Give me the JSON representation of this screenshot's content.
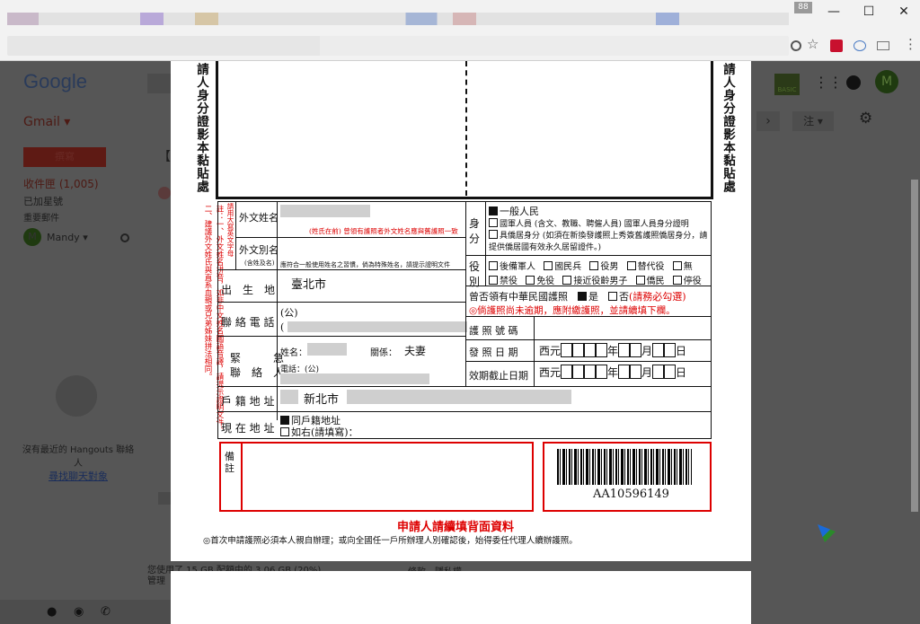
{
  "browser": {
    "tab_badge": "88",
    "window_controls": {
      "minimize": "—",
      "maximize": "☐",
      "close": "✕"
    }
  },
  "gmail": {
    "logo": "Google",
    "label": "Gmail ▾",
    "compose": "撰寫",
    "inbox": "收件匣 (1,005)",
    "starred": "已加星號",
    "important": "重要郵件",
    "user": "Mandy ▾",
    "user_initial": "M",
    "hangouts_empty": "沒有最近的 Hangouts 聯絡人",
    "find_people": "尋找聊天對象",
    "storage": "您使用了 15 GB 配額中的 3.06 GB (20%)",
    "manage": "管理",
    "terms": "條款 - 隱私權",
    "basic_badge": "BASIC",
    "account_initial": "M",
    "toolbar_more": "注 ▾",
    "subject_prefix": "【"
  },
  "form": {
    "photo_label_left": "請人身分證影本黏貼處",
    "photo_label_right": "請人身分證影本黏貼處",
    "note_col": "註：一、外文姓名拼音，如非中文姓名國語音譯，請提示證明文件。二、建議外文姓氏與直系血親或兄弟姊妹拼法相同。",
    "side_red": "請用大寫英文字母",
    "foreign_name": "外文姓名",
    "foreign_alias": "外文別名",
    "alias_sub": "(含姓及名)",
    "name_note": "(姓氏在前) 曾領有護照者外文姓名應與舊護照一致",
    "alias_note": "應符合一般使用姓名之習慣，倘為特殊姓名，請提示證明文件",
    "birthplace": "出　生　地",
    "birthplace_value": "臺北市",
    "phone": "聯 絡 電 話",
    "phone_office": "(公)",
    "phone_home": "(",
    "emergency_1": "緊　　　急",
    "emergency_2": "聯　絡　人",
    "ec_name": "姓名：",
    "ec_relation": "關係：",
    "ec_relation_value": "夫妻",
    "ec_phone": "電話：(公)",
    "household_addr": "戶 籍 地 址",
    "household_value": "新北市",
    "current_addr": "現 在 地 址",
    "same_addr": "同戶籍地址",
    "other_addr": "如右(請填寫)：",
    "identity_label": "身分",
    "identity_opts": [
      "一般人民",
      "國軍人員 (含文、教職、聘僱人員) 國軍人員身分證明",
      "具僑居身分 (如須在新換發護照上秀簽舊護照僑居身分，請提供僑居國有效永久居留證件。)"
    ],
    "service_label": "役別",
    "service_row1": [
      "後備軍人",
      "國民兵",
      "役男",
      "替代役",
      "無"
    ],
    "service_row2": [
      "禁役",
      "免役",
      "接近役齡男子",
      "僑民",
      "停役"
    ],
    "passport_q": "曾否領有中華民國護照",
    "yes": "是",
    "no": "否",
    "must_check": "(請務必勾選)",
    "expired_note": "◎倘護照尚未逾期，應附繳護照，並請續填下欄。",
    "passport_no": "護 照 號 碼",
    "issue_date": "發 照 日 期",
    "expiry_date": "效期截止日期",
    "roc": "西元",
    "year": "年",
    "month": "月",
    "day": "日",
    "remarks": "備　　　　註",
    "barcode_text": "AA10596149",
    "continue_back": "申請人請續填背面資料",
    "footer_note": "◎首次申請護照必須本人親自辦理；或向全國任一戶所辦理人別確認後，始得委任代理人續辦護照。"
  }
}
